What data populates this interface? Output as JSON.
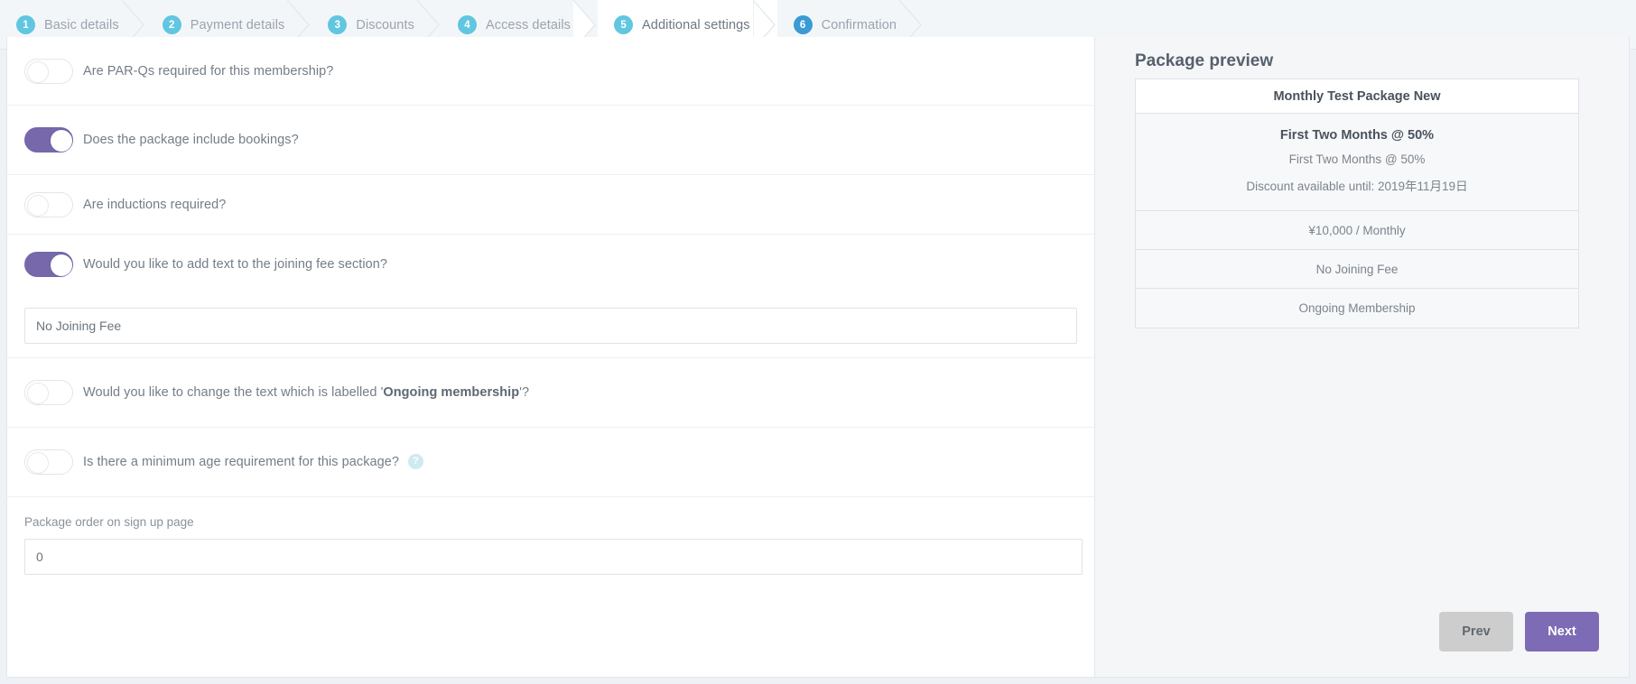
{
  "steps": [
    {
      "num": "1",
      "label": "Basic details",
      "state": "done"
    },
    {
      "num": "2",
      "label": "Payment details",
      "state": "done"
    },
    {
      "num": "3",
      "label": "Discounts",
      "state": "done"
    },
    {
      "num": "4",
      "label": "Access details",
      "state": "done"
    },
    {
      "num": "5",
      "label": "Additional settings",
      "state": "active"
    },
    {
      "num": "6",
      "label": "Confirmation",
      "state": "upcoming"
    }
  ],
  "form": {
    "rows": [
      {
        "label": "Are PAR-Qs required for this membership?",
        "on": false
      },
      {
        "label": "Does the package include bookings?",
        "on": true
      },
      {
        "label": "Are inductions required?",
        "on": false
      },
      {
        "label": "Would you like to add text to the joining fee section?",
        "on": true
      }
    ],
    "joining_fee_value": "No Joining Fee",
    "joining_fee_placeholder": "",
    "ongoing_label_prefix": "Would you like to change the text which is labelled '",
    "ongoing_label_bold": "Ongoing membership",
    "ongoing_label_suffix": "'?",
    "ongoing_on": false,
    "min_age_label": "Is there a minimum age requirement for this package?",
    "min_age_on": false,
    "help_icon_glyph": "?",
    "package_order_label": "Package order on sign up page",
    "package_order_value": "0",
    "package_order_placeholder": ""
  },
  "preview": {
    "title": "Package preview",
    "package_name": "Monthly Test Package New",
    "discount_title": "First Two Months @ 50%",
    "discount_sub": "First Two Months @ 50%",
    "discount_until": "Discount available until: 2019年11月19日",
    "price": "¥10,000 / Monthly",
    "joining_fee": "No Joining Fee",
    "term": "Ongoing Membership"
  },
  "footer": {
    "prev_label": "Prev",
    "next_label": "Next"
  },
  "colors": {
    "accent_purple": "#7668ab",
    "next_button": "#7d6cb5",
    "step_circle": "#61c6e0",
    "step_circle_last": "#3a9bd5",
    "help_icon": "#cfeaf0"
  }
}
